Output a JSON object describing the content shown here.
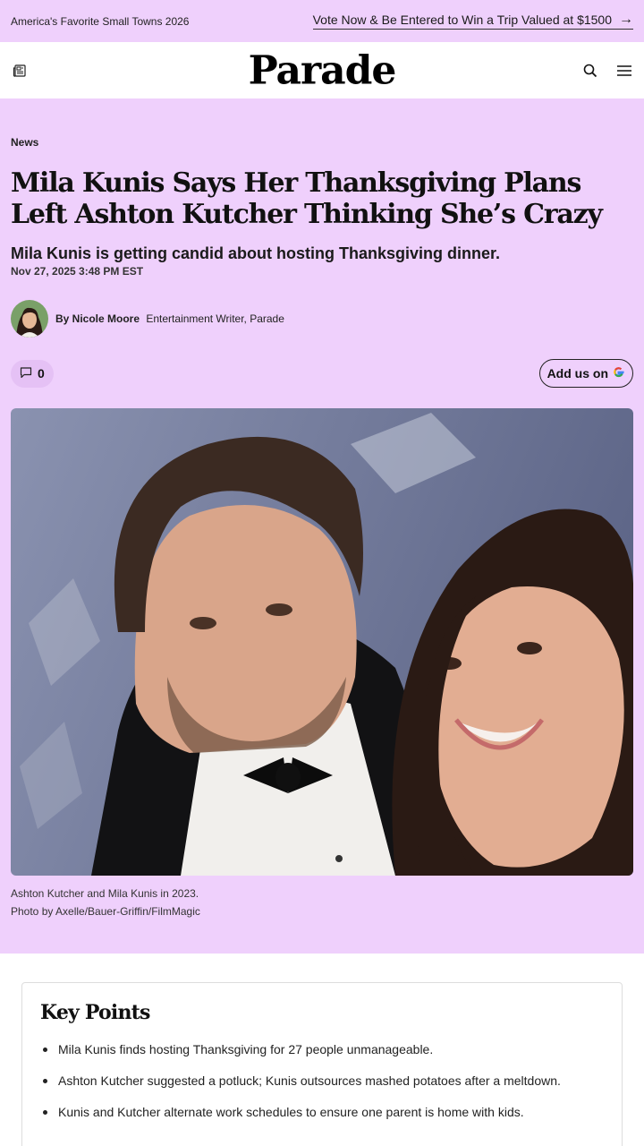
{
  "promo": {
    "left_text": "America's Favorite Small Towns 2026",
    "right_text": "Vote Now & Be Entered to Win a Trip Valued at $1500",
    "arrow_icon": "arrow-right-icon"
  },
  "header": {
    "logo": "Parade",
    "left_icon": "newspaper-icon",
    "search_icon": "search-icon",
    "menu_icon": "menu-icon"
  },
  "article": {
    "category": "News",
    "headline": "Mila Kunis Says Her Thanksgiving Plans Left Ashton Kutcher Thinking She’s Crazy",
    "dek": "Mila Kunis is getting candid about hosting Thanksgiving dinner.",
    "date": "Nov 27, 2025 3:48 PM EST",
    "byline": {
      "author": "By Nicole Moore",
      "role": "Entertainment Writer, Parade"
    },
    "comments": {
      "count": "0",
      "icon": "comment-icon"
    },
    "add_us": {
      "label": "Add us on",
      "icon": "google-icon"
    },
    "photo": {
      "caption": "Ashton Kutcher and Mila Kunis in 2023.",
      "credit": "Photo by Axelle/Bauer-Griffin/FilmMagic"
    }
  },
  "key_points": {
    "title": "Key Points",
    "items": [
      "Mila Kunis finds hosting Thanksgiving for 27 people unmanageable.",
      "Ashton Kutcher suggested a potluck; Kunis outsources mashed potatoes after a meltdown.",
      "Kunis and Kutcher alternate work schedules to ensure one parent is home with kids."
    ]
  },
  "colors": {
    "brand_bg": "#efd0fc",
    "text": "#111111"
  }
}
